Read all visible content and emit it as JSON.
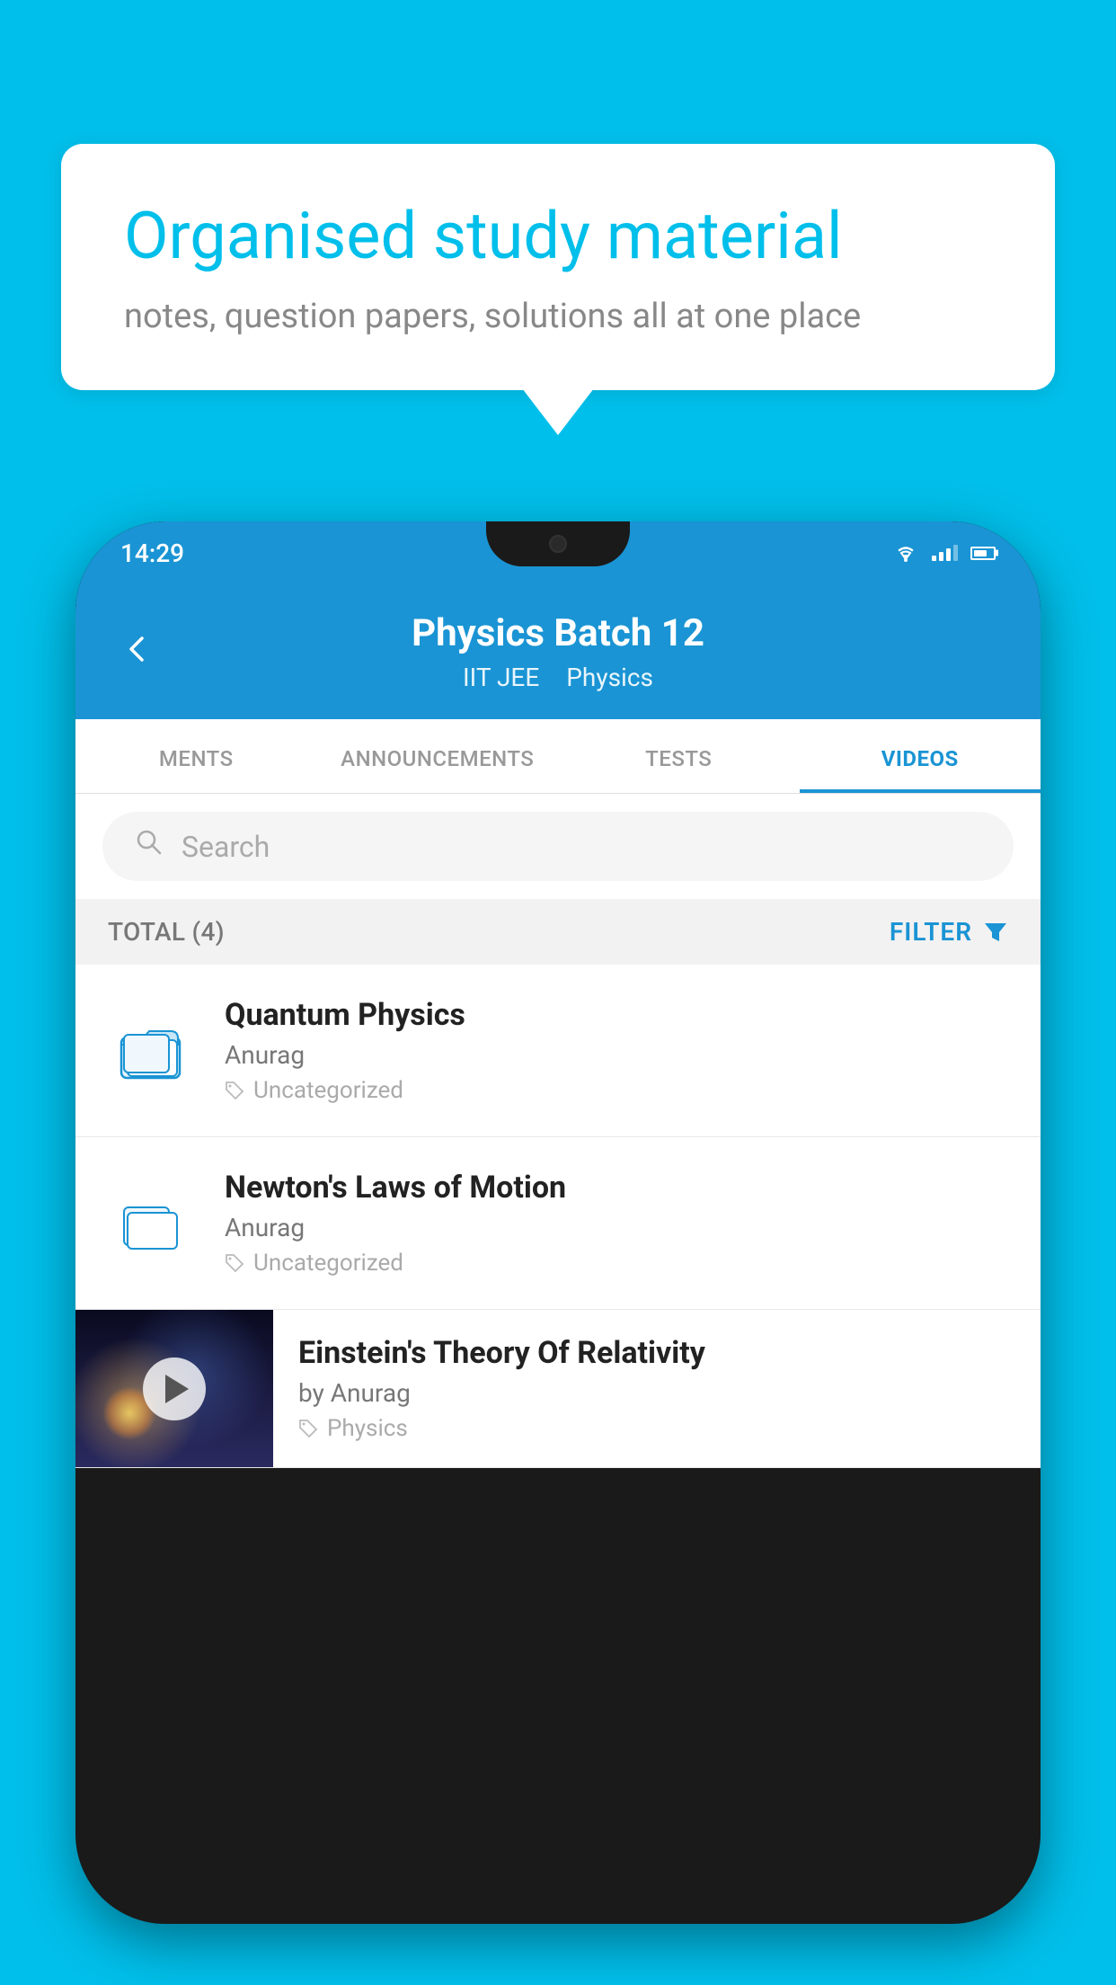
{
  "background": {
    "color": "#00BFEA"
  },
  "speech_bubble": {
    "title": "Organised study material",
    "subtitle": "notes, question papers, solutions all at one place"
  },
  "phone": {
    "status_bar": {
      "time": "14:29"
    },
    "header": {
      "title": "Physics Batch 12",
      "tag1": "IIT JEE",
      "tag2": "Physics",
      "back_label": "←"
    },
    "tabs": [
      {
        "label": "MENTS",
        "active": false
      },
      {
        "label": "ANNOUNCEMENTS",
        "active": false
      },
      {
        "label": "TESTS",
        "active": false
      },
      {
        "label": "VIDEOS",
        "active": true
      }
    ],
    "search": {
      "placeholder": "Search"
    },
    "filter": {
      "total_label": "TOTAL (4)",
      "filter_label": "FILTER"
    },
    "videos": [
      {
        "title": "Quantum Physics",
        "author": "Anurag",
        "tag": "Uncategorized",
        "type": "folder"
      },
      {
        "title": "Newton's Laws of Motion",
        "author": "Anurag",
        "tag": "Uncategorized",
        "type": "folder"
      },
      {
        "title": "Einstein's Theory Of Relativity",
        "author": "by Anurag",
        "tag": "Physics",
        "type": "video"
      }
    ]
  }
}
